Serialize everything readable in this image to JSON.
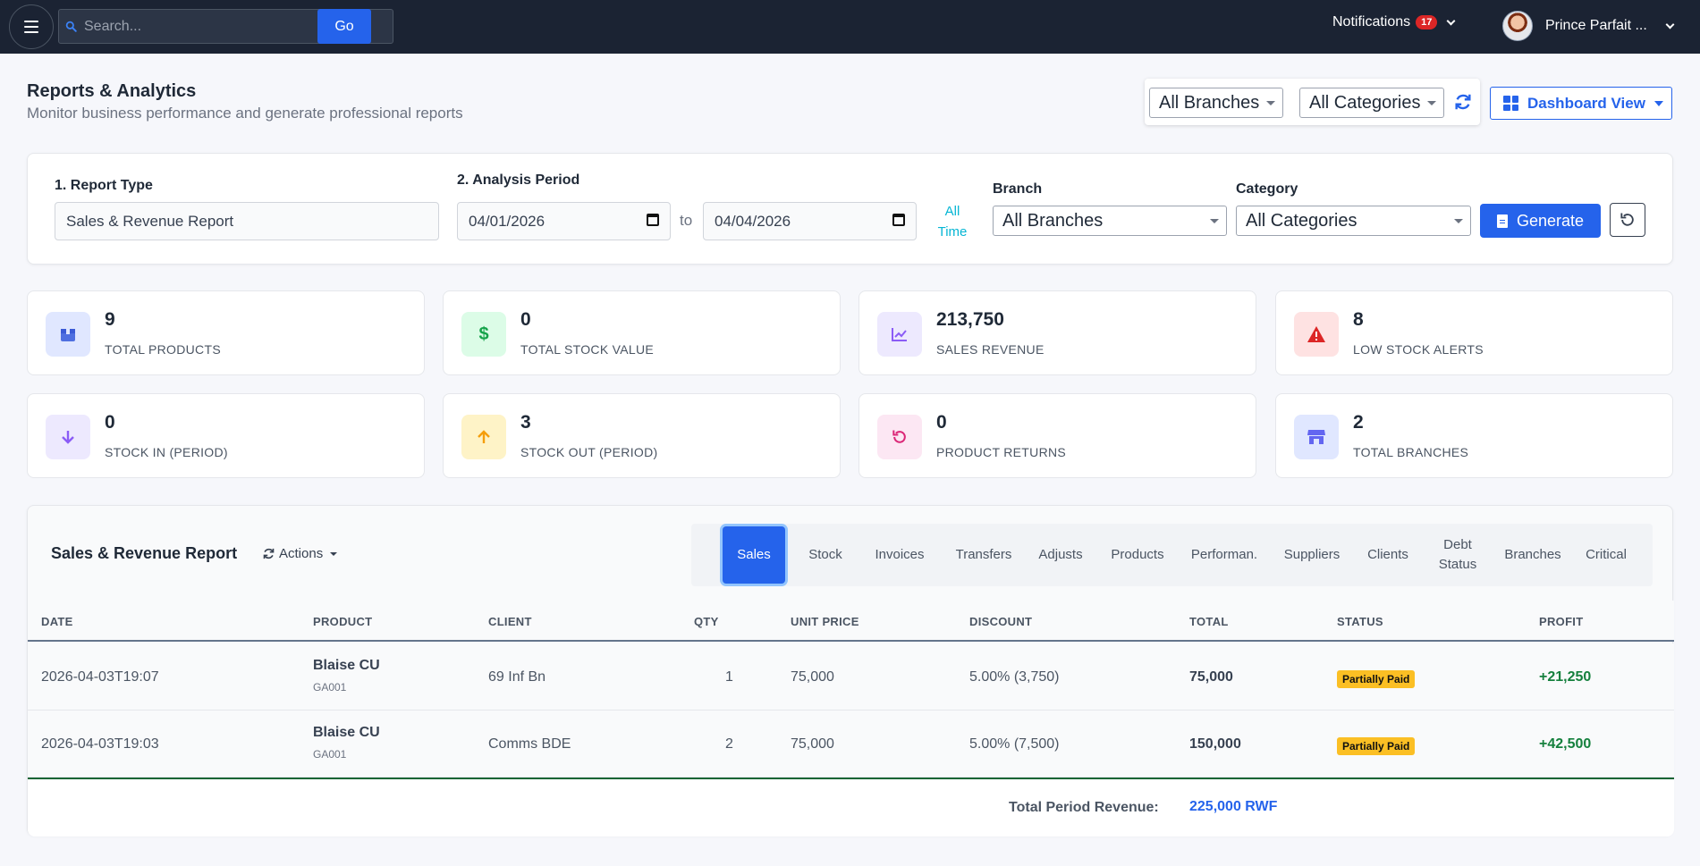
{
  "topbar": {
    "search_placeholder": "Search...",
    "go_label": "Go",
    "notifications_label": "Notifications",
    "notifications_count": "17",
    "user_name": "Prince Parfait ..."
  },
  "header": {
    "title": "Reports & Analytics",
    "subtitle": "Monitor business performance and generate professional reports",
    "branch_filter": "All Branches",
    "category_filter": "All Categories",
    "view_button": "Dashboard View"
  },
  "form": {
    "report_type_label": "1. Report Type",
    "report_type_value": "Sales & Revenue Report",
    "period_label": "2. Analysis Period",
    "start_date": "04/01/2026",
    "to_label": "to",
    "end_date": "04/04/2026",
    "all_time_line1": "All",
    "all_time_line2": "Time",
    "branch_label": "Branch",
    "branch_value": "All Branches",
    "category_label": "Category",
    "category_value": "All Categories",
    "generate_label": "Generate"
  },
  "stats": [
    {
      "value": "9",
      "label": "TOTAL PRODUCTS",
      "icon": "box-icon",
      "color": "#4f6fe0"
    },
    {
      "value": "0",
      "label": "TOTAL STOCK VALUE",
      "icon": "dollar-icon",
      "color": "#16a34a"
    },
    {
      "value": "213,750",
      "label": "SALES REVENUE",
      "icon": "chart-line-icon",
      "color": "#8b5cf6"
    },
    {
      "value": "8",
      "label": "LOW STOCK ALERTS",
      "icon": "warning-icon",
      "color": "#dc2626"
    },
    {
      "value": "0",
      "label": "STOCK IN (PERIOD)",
      "icon": "arrow-down-icon",
      "color": "#8b5cf6"
    },
    {
      "value": "3",
      "label": "STOCK OUT (PERIOD)",
      "icon": "arrow-up-icon",
      "color": "#f59e0b"
    },
    {
      "value": "0",
      "label": "PRODUCT RETURNS",
      "icon": "undo-icon",
      "color": "#db2777"
    },
    {
      "value": "2",
      "label": "TOTAL BRANCHES",
      "icon": "store-icon",
      "color": "#6366f1"
    }
  ],
  "report": {
    "title": "Sales & Revenue Report",
    "actions_label": "Actions",
    "tabs": [
      {
        "label": "Sales",
        "label2": ""
      },
      {
        "label": "Stock",
        "label2": ""
      },
      {
        "label": "Invoices",
        "label2": ""
      },
      {
        "label": "Transfers",
        "label2": ""
      },
      {
        "label": "Adjusts",
        "label2": ""
      },
      {
        "label": "Products",
        "label2": ""
      },
      {
        "label": "Performan.",
        "label2": ""
      },
      {
        "label": "Suppliers",
        "label2": ""
      },
      {
        "label": "Clients",
        "label2": ""
      },
      {
        "label": "Debt",
        "label2": "Status"
      },
      {
        "label": "Branches",
        "label2": ""
      },
      {
        "label": "Critical",
        "label2": ""
      }
    ],
    "columns": [
      "DATE",
      "PRODUCT",
      "CLIENT",
      "QTY",
      "UNIT PRICE",
      "DISCOUNT",
      "TOTAL",
      "STATUS",
      "PROFIT"
    ],
    "rows": [
      {
        "date": "2026-04-03T19:07",
        "product": "Blaise CU",
        "sku": "GA001",
        "client": "69 Inf Bn",
        "qty": "1",
        "unit_price": "75,000",
        "discount": "5.00% (3,750)",
        "total": "75,000",
        "status": "Partially Paid",
        "profit": "+21,250"
      },
      {
        "date": "2026-04-03T19:03",
        "product": "Blaise CU",
        "sku": "GA001",
        "client": "Comms BDE",
        "qty": "2",
        "unit_price": "75,000",
        "discount": "5.00% (7,500)",
        "total": "150,000",
        "status": "Partially Paid",
        "profit": "+42,500"
      }
    ],
    "footer_label": "Total Period Revenue:",
    "footer_value": "225,000 RWF"
  }
}
